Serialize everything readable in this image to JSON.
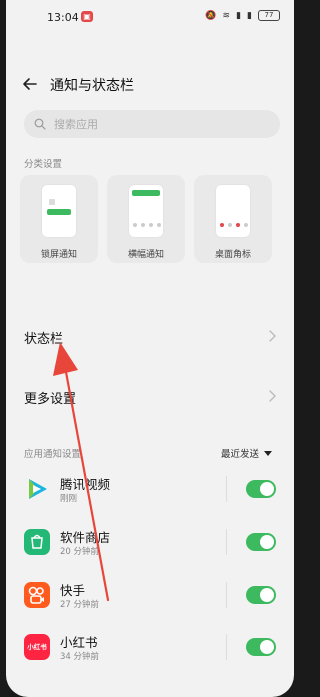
{
  "status_bar": {
    "time": "13:04",
    "battery": "77"
  },
  "header": {
    "title": "通知与状态栏"
  },
  "search": {
    "placeholder": "搜索应用"
  },
  "categories_section": {
    "label": "分类设置",
    "cards": [
      {
        "label": "锁屏通知"
      },
      {
        "label": "横幅通知"
      },
      {
        "label": "桌面角标"
      }
    ]
  },
  "menu": {
    "status_bar_label": "状态栏",
    "more_settings_label": "更多设置"
  },
  "app_section": {
    "label": "应用通知设置",
    "sort_label": "最近发送"
  },
  "apps": [
    {
      "name": "腾讯视频",
      "time": "刚刚",
      "icon": "tencent-video-icon",
      "enabled": true
    },
    {
      "name": "软件商店",
      "time": "20 分钟前",
      "icon": "app-store-icon",
      "enabled": true
    },
    {
      "name": "快手",
      "time": "27 分钟前",
      "icon": "kuaishou-icon",
      "enabled": true
    },
    {
      "name": "小红书",
      "time": "34 分钟前",
      "icon": "xiaohongshu-icon",
      "icon_text": "小红书",
      "enabled": true
    }
  ],
  "colors": {
    "accent": "#3dba5f",
    "annotation": "#e8463a"
  }
}
